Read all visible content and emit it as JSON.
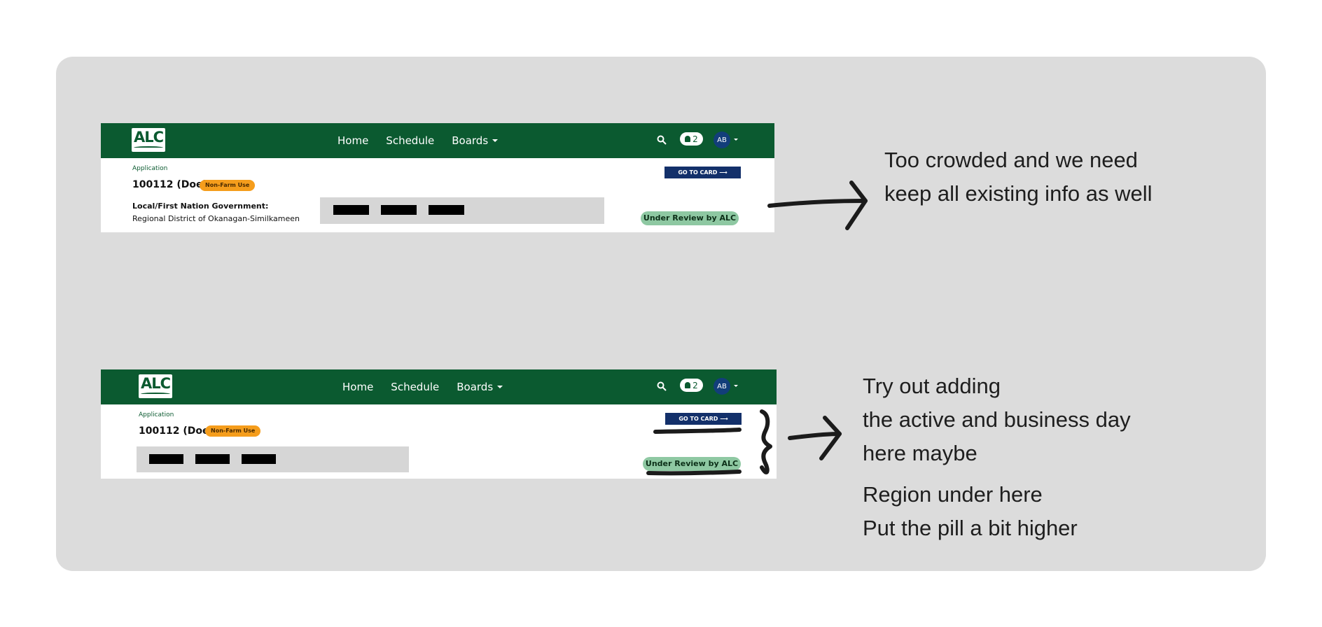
{
  "colors": {
    "board_bg": "#dcdcdc",
    "nav_green": "#0b5a30",
    "tag_orange": "#f59d1c",
    "button_navy": "#13306a",
    "pill_green": "#8ec8a2",
    "avatar_blue": "#123e7a"
  },
  "mockups": [
    {
      "logo": "ALC",
      "nav_links": [
        "Home",
        "Schedule",
        "Boards"
      ],
      "notification_count": "2",
      "avatar_initials": "AB",
      "app_label": "Application",
      "file_title": "100112 (Doe)",
      "tag": "Non-Farm Use",
      "government_label": "Local/First Nation Government:",
      "government_value": "Regional District of Okanagan-Similkameen",
      "go_to_card": "GO TO CARD ⟶",
      "status_pill": "Under Review by ALC"
    },
    {
      "logo": "ALC",
      "nav_links": [
        "Home",
        "Schedule",
        "Boards"
      ],
      "notification_count": "2",
      "avatar_initials": "AB",
      "app_label": "Application",
      "file_title": "100112 (Doe)",
      "tag": "Non-Farm Use",
      "go_to_card": "GO TO CARD ⟶",
      "status_pill": "Under Review by ALC"
    }
  ],
  "notes": {
    "first": [
      "Too crowded and we need",
      "keep all existing info as well"
    ],
    "second": [
      "Try out adding",
      "the active and business day",
      "here maybe"
    ],
    "third": [
      "Region under here",
      "Put the pill a bit higher"
    ]
  }
}
